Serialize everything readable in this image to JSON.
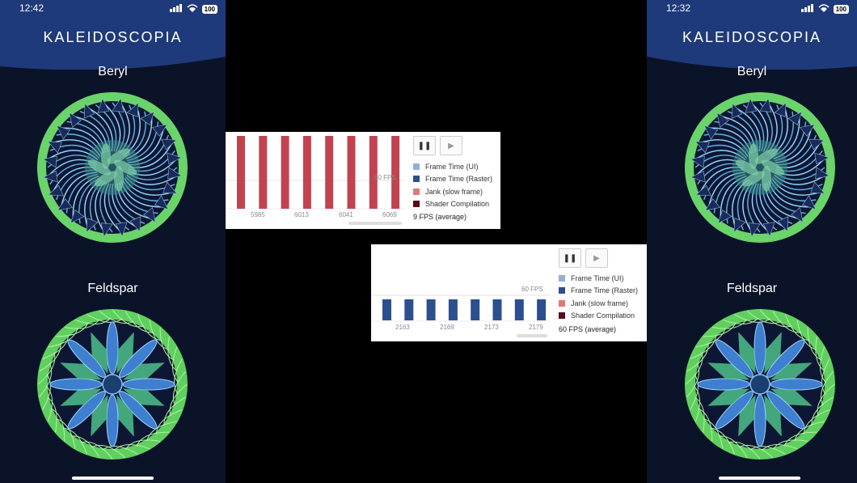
{
  "left_phone": {
    "time": "12:42",
    "battery": "100",
    "app_title": "KALEIDOSCOPIA",
    "items": [
      {
        "label": "Beryl"
      },
      {
        "label": "Feldspar"
      }
    ]
  },
  "right_phone": {
    "time": "12:32",
    "battery": "100",
    "app_title": "KALEIDOSCOPIA",
    "items": [
      {
        "label": "Beryl"
      },
      {
        "label": "Feldspar"
      }
    ]
  },
  "legend": [
    "Frame Time (UI)",
    "Frame Time (Raster)",
    "Jank (slow frame)",
    "Shader Compilation"
  ],
  "legend_colors": [
    "#8fb0d8",
    "#2c4f8f",
    "#e07a7a",
    "#5a0a1a"
  ],
  "panel_top": {
    "fps_line": "60 FPS",
    "ticks": [
      "5985",
      "6013",
      "6041",
      "6069"
    ],
    "average": "9 FPS (average)",
    "bar_color": "#c2434f",
    "bar_count": 8
  },
  "panel_bottom": {
    "fps_line": "60 FPS",
    "ticks": [
      "2163",
      "2169",
      "2173",
      "2179"
    ],
    "average": "60 FPS (average)",
    "bar_color": "#2c4f8f",
    "bar_count": 8
  },
  "controls": {
    "pause": "❚❚",
    "play": "▶"
  }
}
